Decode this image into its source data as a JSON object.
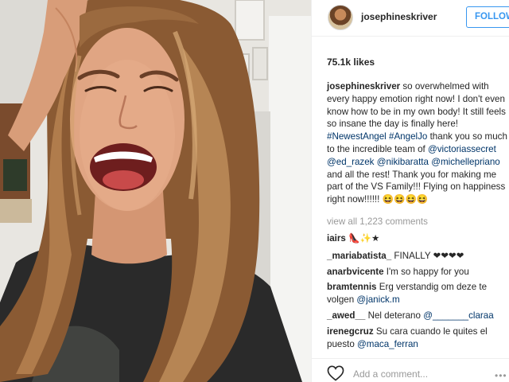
{
  "post": {
    "username": "josephineskriver",
    "follow_label": "FOLLOW",
    "likes": "75.1k likes",
    "caption": {
      "username": "josephineskriver",
      "p1": " so overwhelmed with every happy emotion right now! I don't even know how to be in my own body! It still feels so insane the day is finally here! ",
      "tag1": "#NewestAngel",
      "p2": " ",
      "tag2": "#AngelJo",
      "p3": " thank you so much to the incredible team of ",
      "m1": "@victoriassecret",
      "p4": " ",
      "m2": "@ed_razek",
      "p5": " ",
      "m3": "@nikibaratta",
      "p6": " ",
      "m4": "@michellepriano",
      "p7": " and all the rest! Thank you for making me part of the VS Family!!! Flying on happiness right now!!!!!! 😆😆😆😆"
    },
    "view_all": "view all 1,223 comments",
    "comments": [
      {
        "user": "iairs",
        "text": " 👠✨★"
      },
      {
        "user": "_mariabatista_",
        "text": " FINALLY ❤❤❤❤"
      },
      {
        "user": "anarbvicente",
        "text": " I'm so happy for you"
      },
      {
        "user": "bramtennis",
        "text": " Erg verstandig om deze te volgen ",
        "mention": "@janick.m"
      },
      {
        "user": "_awed__",
        "text": " Nel deterano ",
        "mention": "@_______claraa"
      },
      {
        "user": "irenegcruz",
        "text": " Su cara cuando le quites el puesto ",
        "mention": "@maca_ferran"
      }
    ],
    "add_comment_placeholder": "Add a comment...",
    "more_icon": "•••"
  },
  "colors": {
    "accent": "#3897f0",
    "link": "#003569",
    "muted": "#999999",
    "text": "#262626"
  },
  "icons": [
    "heart-icon",
    "more-options-icon"
  ]
}
